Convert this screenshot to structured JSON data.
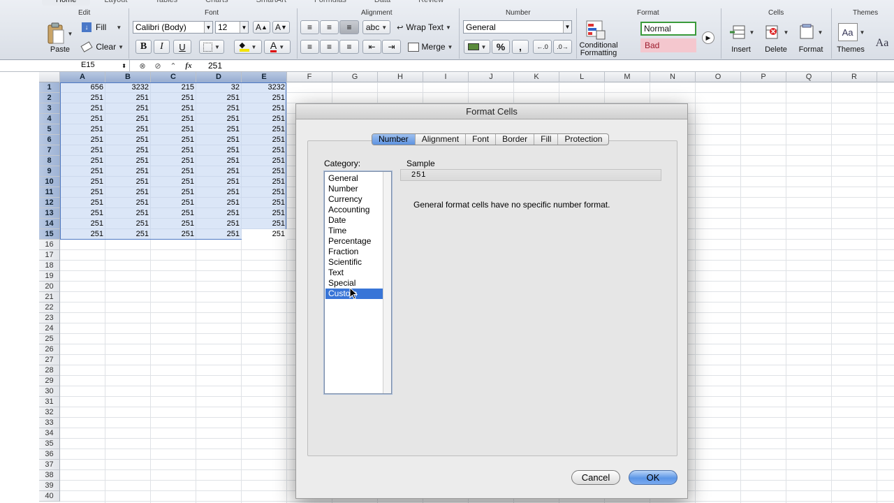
{
  "ribbon": {
    "tabs": [
      "Home",
      "Layout",
      "Tables",
      "Charts",
      "SmartArt",
      "Formulas",
      "Data",
      "Review"
    ],
    "groups": {
      "edit": "Edit",
      "font": "Font",
      "alignment": "Alignment",
      "number": "Number",
      "format": "Format",
      "cells": "Cells",
      "themes": "Themes"
    },
    "paste_label": "Paste",
    "fill_label": "Fill",
    "clear_label": "Clear",
    "font_name": "Calibri (Body)",
    "font_size": "12",
    "bold": "B",
    "italic": "I",
    "underline": "U",
    "grow_font": "A",
    "shrink_font": "A",
    "wrap_label": "abc",
    "wrap_text_label": "Wrap Text",
    "merge_label": "Merge",
    "number_format": "General",
    "percent_label": "%",
    "comma_label": ",",
    "cond_format_label_1": "Conditional",
    "cond_format_label_2": "Formatting",
    "style_normal": "Normal",
    "style_bad": "Bad",
    "insert_label": "Insert",
    "delete_label": "Delete",
    "format_label": "Format",
    "themes_label": "Themes",
    "themes_aa": "Aa"
  },
  "formula_bar": {
    "name_box": "E15",
    "fx": "fx",
    "value": "251"
  },
  "grid": {
    "columns": [
      "A",
      "B",
      "C",
      "D",
      "E",
      "F",
      "G",
      "H",
      "I",
      "J",
      "K",
      "L",
      "M",
      "N",
      "O",
      "P",
      "Q",
      "R"
    ],
    "rows": [
      "1",
      "2",
      "3",
      "4",
      "5",
      "6",
      "7",
      "8",
      "9",
      "10",
      "11",
      "12",
      "13",
      "14",
      "15",
      "16",
      "17",
      "18",
      "19",
      "20",
      "21",
      "22",
      "23",
      "24",
      "25",
      "26",
      "27",
      "28",
      "29",
      "30",
      "31",
      "32",
      "33",
      "34",
      "35",
      "36",
      "37",
      "38",
      "39",
      "40"
    ],
    "row1": [
      "656",
      "3232",
      "215",
      "32",
      "3232"
    ],
    "row_other": [
      "251",
      "251",
      "251",
      "251",
      "251"
    ]
  },
  "dialog": {
    "title": "Format Cells",
    "tabs": [
      "Number",
      "Alignment",
      "Font",
      "Border",
      "Fill",
      "Protection"
    ],
    "category_label": "Category:",
    "categories": [
      "General",
      "Number",
      "Currency",
      "Accounting",
      "Date",
      "Time",
      "Percentage",
      "Fraction",
      "Scientific",
      "Text",
      "Special",
      "Custom"
    ],
    "selected_category": "Custom",
    "sample_label": "Sample",
    "sample_value": "251",
    "description": "General format cells have no specific number format.",
    "cancel": "Cancel",
    "ok": "OK"
  },
  "colors": {
    "selection": "#bed2f0",
    "accent": "#3875d7",
    "bad_fill": "#f4c7ce",
    "normal_border": "#3a9a3a"
  }
}
